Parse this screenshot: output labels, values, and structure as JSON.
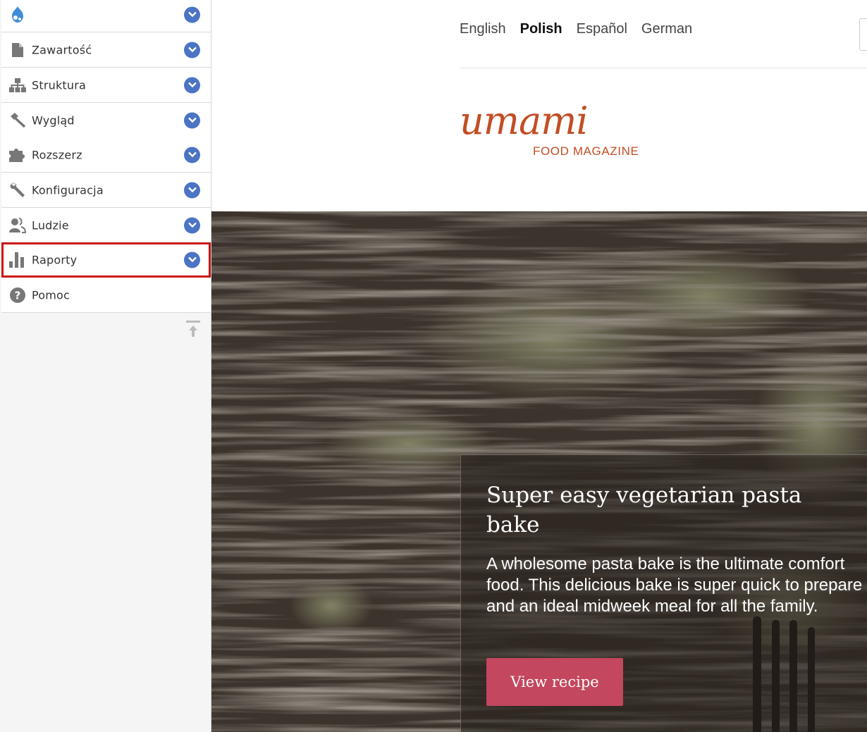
{
  "toolbar": {
    "items": [
      {
        "label": "Zawartość",
        "icon": "page-icon"
      },
      {
        "label": "Struktura",
        "icon": "hierarchy-icon"
      },
      {
        "label": "Wygląd",
        "icon": "brush-icon"
      },
      {
        "label": "Rozszerz",
        "icon": "puzzle-icon"
      },
      {
        "label": "Konfiguracja",
        "icon": "wrench-icon"
      },
      {
        "label": "Ludzie",
        "icon": "people-icon"
      },
      {
        "label": "Raporty",
        "icon": "bar-chart-icon",
        "highlighted": true
      },
      {
        "label": "Pomoc",
        "icon": "help-icon"
      }
    ],
    "colors": {
      "toggle": "#4b74c4",
      "highlight_border": "#cc1414",
      "icon": "#777777"
    }
  },
  "languages": {
    "items": [
      "English",
      "Polish",
      "Español",
      "German"
    ],
    "active": "Polish"
  },
  "logo": {
    "word": "umami",
    "subtitle": "FOOD MAGAZINE",
    "color": "#c24e24"
  },
  "hero": {
    "title": "Super easy vegetarian pasta bake",
    "description": "A wholesome pasta bake is the ultimate comfort food. This delicious bake is super quick to prepare and an ideal midweek meal for all the family.",
    "button_label": "View recipe",
    "button_color": "#c3475e"
  }
}
